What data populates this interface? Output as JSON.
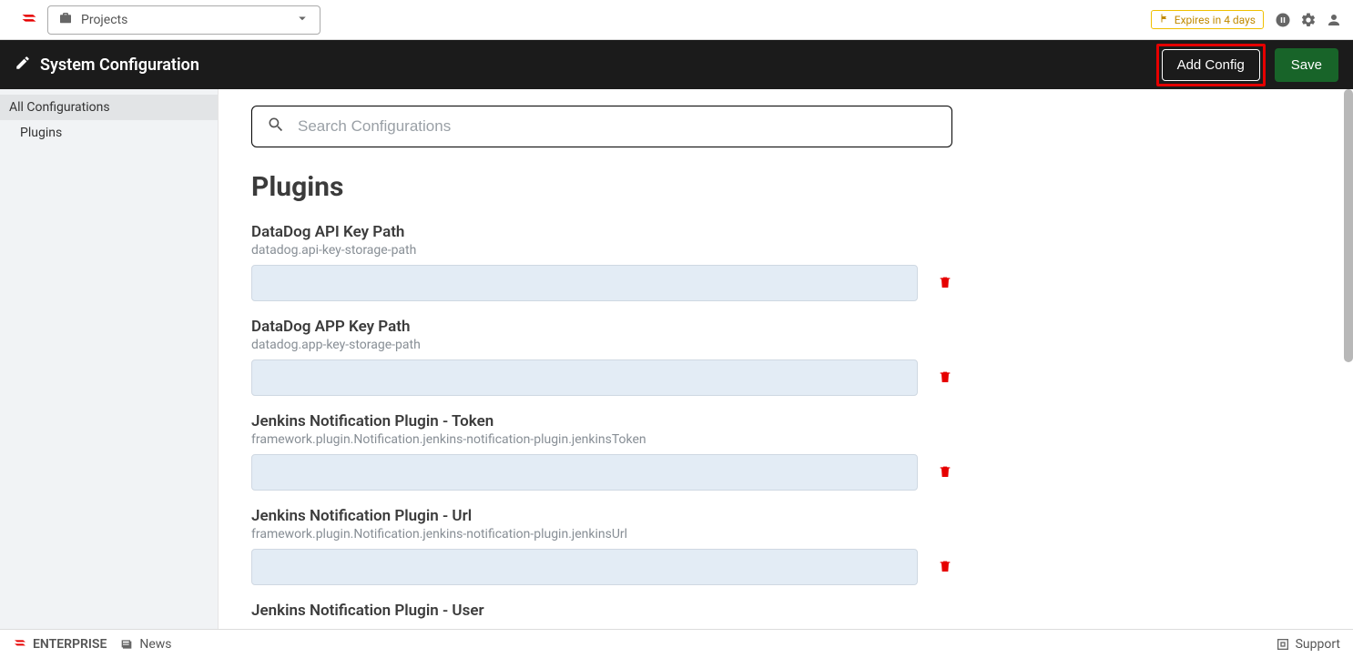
{
  "topbar": {
    "project_label": "Projects",
    "expires_label": "Expires in 4 days"
  },
  "header": {
    "title": "System Configuration",
    "add_config_label": "Add Config",
    "save_label": "Save"
  },
  "sidebar": {
    "all_label": "All Configurations",
    "items": [
      {
        "label": "Plugins"
      }
    ]
  },
  "search": {
    "placeholder": "Search Configurations"
  },
  "section_title": "Plugins",
  "configs": [
    {
      "label": "DataDog API Key Path",
      "key": "datadog.api-key-storage-path",
      "value": ""
    },
    {
      "label": "DataDog APP Key Path",
      "key": "datadog.app-key-storage-path",
      "value": ""
    },
    {
      "label": "Jenkins Notification Plugin - Token",
      "key": "framework.plugin.Notification.jenkins-notification-plugin.jenkinsToken",
      "value": ""
    },
    {
      "label": "Jenkins Notification Plugin - Url",
      "key": "framework.plugin.Notification.jenkins-notification-plugin.jenkinsUrl",
      "value": ""
    },
    {
      "label": "Jenkins Notification Plugin - User",
      "key": "",
      "value": ""
    }
  ],
  "footer": {
    "brand": "ENTERPRISE",
    "news_label": "News",
    "support_label": "Support"
  }
}
